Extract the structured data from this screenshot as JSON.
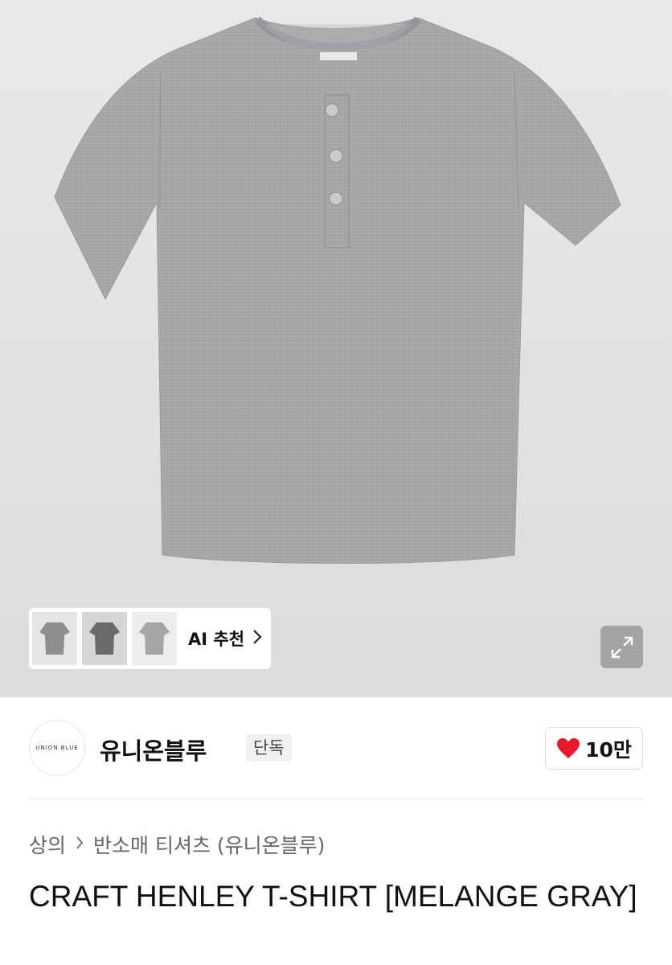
{
  "reco": {
    "label": "AI 추천"
  },
  "brand": {
    "name": "유니온블루",
    "logo_text": "UNION BLUE",
    "badge": "단독"
  },
  "likes": {
    "count": "10만"
  },
  "breadcrumb": {
    "category": "상의",
    "subcategory": "반소매 티셔츠 (유니온블루)"
  },
  "product": {
    "title": "CRAFT HENLEY T-SHIRT [MELANGE GRAY]"
  },
  "colors": {
    "heart": "#e8192c",
    "shirt": "#a9a9ab",
    "expand_bg": "#a3a3a5"
  },
  "icons": {
    "heart": "heart-icon",
    "expand": "expand-icon",
    "chevron": "chevron-right-icon"
  }
}
